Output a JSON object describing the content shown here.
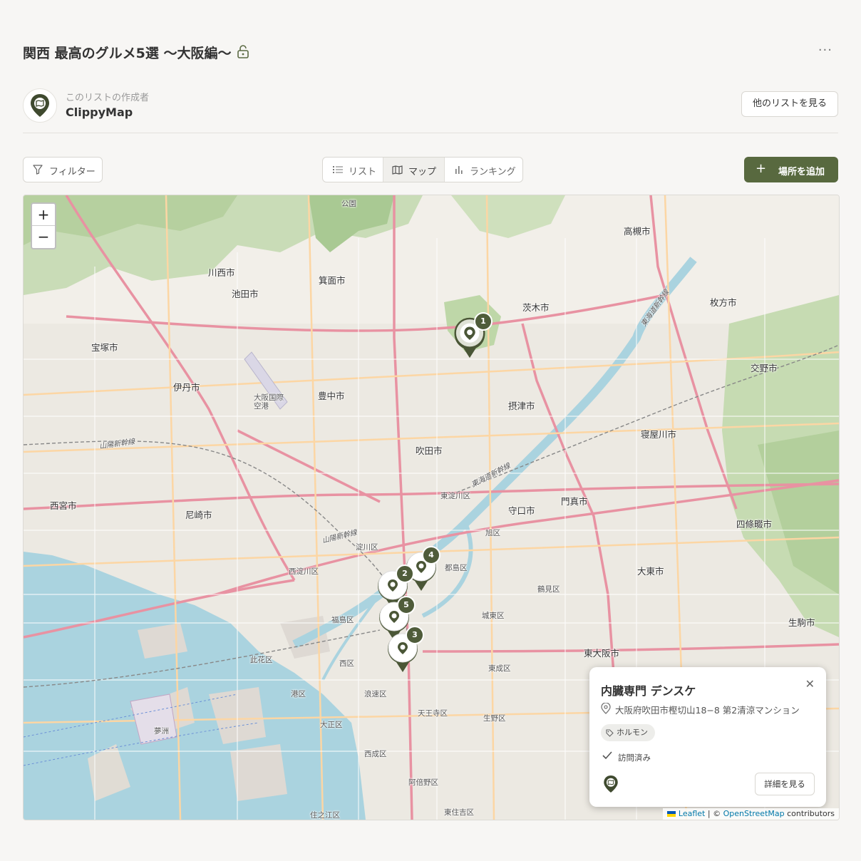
{
  "header": {
    "title": "関西 最高のグルメ5選 〜大阪編〜",
    "more_label": "···"
  },
  "creator": {
    "subtitle": "このリストの作成者",
    "name": "ClippyMap",
    "other_lists_button": "他のリストを見る"
  },
  "toolbar": {
    "filter_label": "フィルター",
    "views": [
      {
        "label": "リスト",
        "icon": "list-icon",
        "active": false
      },
      {
        "label": "マップ",
        "icon": "map-icon",
        "active": true
      },
      {
        "label": "ランキング",
        "icon": "bar-chart-icon",
        "active": false
      }
    ],
    "add_place_label": "場所を追加",
    "add_place_icon": "+"
  },
  "map": {
    "zoom_in": "+",
    "zoom_out": "−",
    "places": {
      "takatsuki": "高槻市",
      "kawanishi": "川西市",
      "minoh": "箕面市",
      "ikeda": "池田市",
      "ibaraki": "茨木市",
      "hirakata": "枚方市",
      "takarazuka": "宝塚市",
      "katano": "交野市",
      "itami": "伊丹市",
      "toyonaka": "豊中市",
      "settsu": "摂津市",
      "neyagawa": "寝屋川市",
      "suita": "吹田市",
      "airport": "大阪国際空港",
      "higashiyodogawa": "東淀川区",
      "nishinomiya": "西宮市",
      "amagasaki": "尼崎市",
      "moriguchi": "守口市",
      "kadoma": "門真市",
      "shijonawate": "四條畷市",
      "asahi": "旭区",
      "yodogawa": "淀川区",
      "miyakojima": "都島区",
      "nishiyodogawa": "西淀川区",
      "daito": "大東市",
      "tsurumi": "鶴見区",
      "fukushima": "福島区",
      "joto": "城東区",
      "ikoma": "生駒市",
      "higashiosaka": "東大阪市",
      "konohana": "此花区",
      "nishi": "西区",
      "higashinari": "東成区",
      "minato": "港区",
      "naniwa": "浪速区",
      "tennoji": "天王寺区",
      "ikuno": "生野区",
      "yumeshima": "夢洲",
      "taisho": "大正区",
      "nishinari": "西成区",
      "abeno": "阿倍野区",
      "sumiyoshi": "住之江区",
      "higashisumiyoshi": "東住吉区",
      "park": "公園",
      "sanyo": "山陽新幹線",
      "tokaido": "東海道新幹線"
    },
    "pins": [
      {
        "number": "1",
        "name": "内臓専門 デンスケ",
        "selected": true
      },
      {
        "number": "2",
        "name": "",
        "selected": false
      },
      {
        "number": "3",
        "name": "",
        "selected": false
      },
      {
        "number": "4",
        "name": "",
        "selected": false
      },
      {
        "number": "5",
        "name": "",
        "selected": false
      }
    ],
    "popup": {
      "title": "内臓専門 デンスケ",
      "address": "大阪府吹田市樫切山18−8 第2清涼マンション",
      "tag": "ホルモン",
      "status": "訪問済み",
      "detail_button": "詳細を見る",
      "close": "✕"
    },
    "attribution": {
      "leaflet": "Leaflet",
      "sep": " | © ",
      "osm": "OpenStreetMap",
      "contrib": " contributors"
    }
  },
  "colors": {
    "accent": "#58693f",
    "pin_badge": "#4f5c3a",
    "map_bg": "#f2efe9",
    "water": "#aad3df",
    "forest": "#add19e"
  }
}
